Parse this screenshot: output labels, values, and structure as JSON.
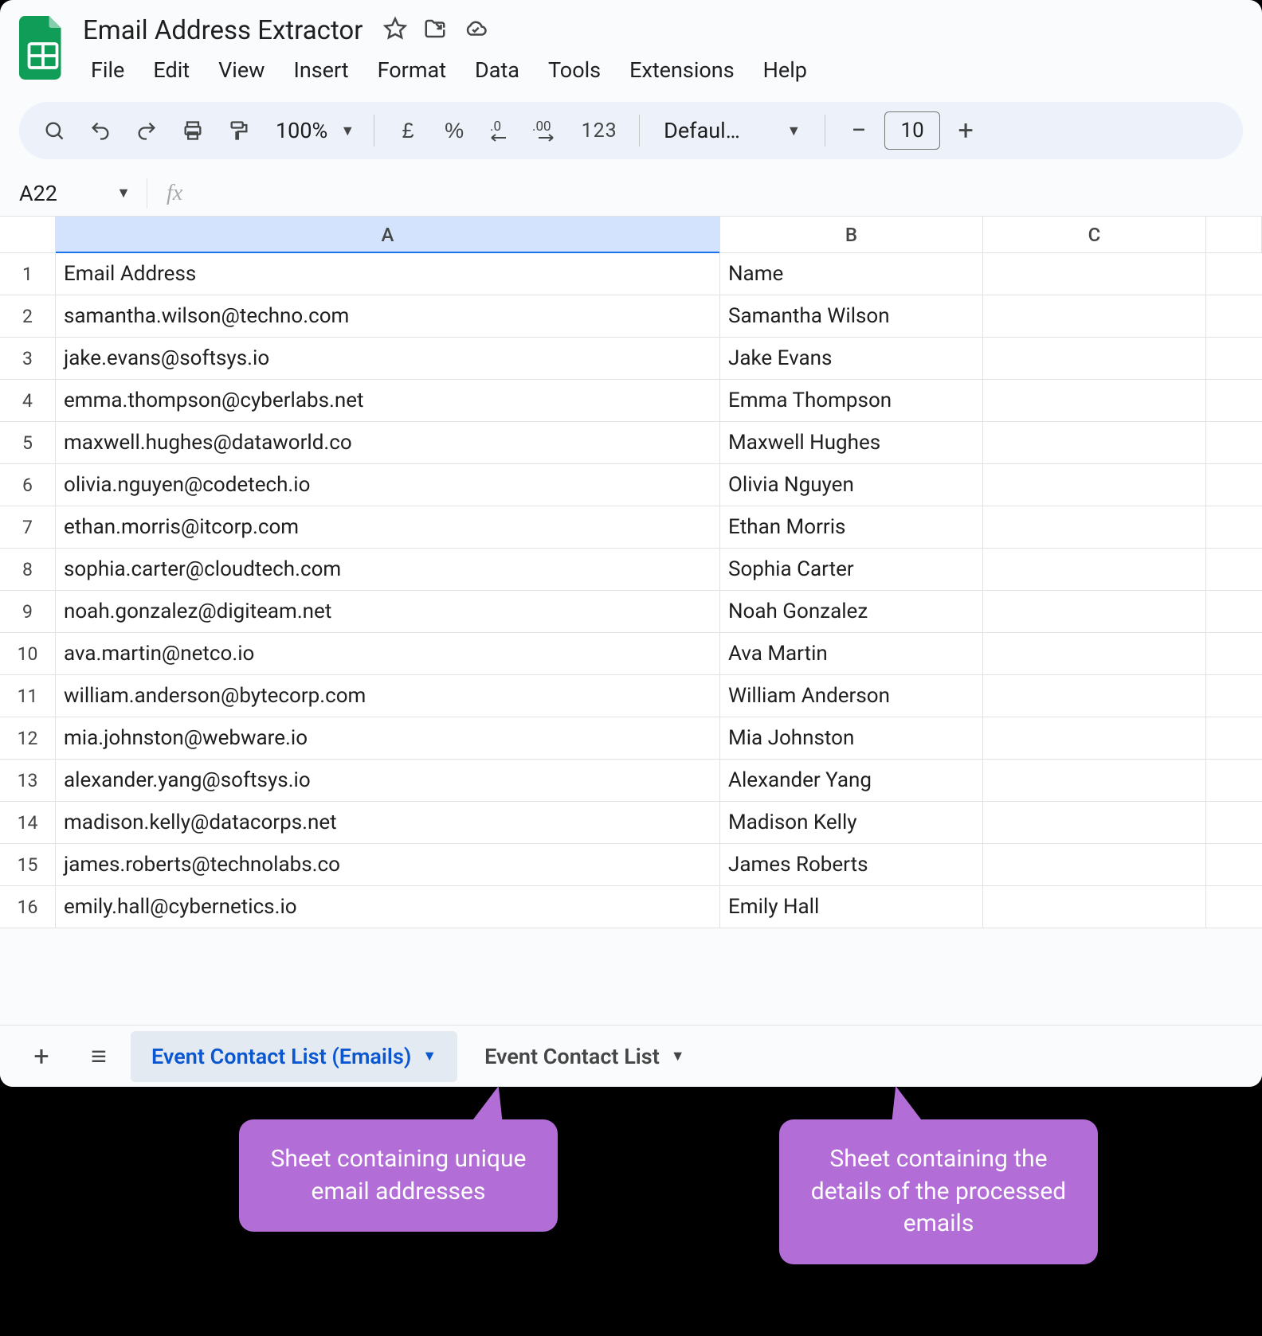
{
  "header": {
    "doc_title": "Email Address Extractor",
    "menus": [
      "File",
      "Edit",
      "View",
      "Insert",
      "Format",
      "Data",
      "Tools",
      "Extensions",
      "Help"
    ]
  },
  "toolbar": {
    "zoom": "100%",
    "currency": "£",
    "percent": "%",
    "dec_dec": ".0",
    "inc_dec": ".00",
    "numfmt": "123",
    "font": "Defaul…",
    "font_size": "10"
  },
  "namebox": "A22",
  "columns": [
    "A",
    "B",
    "C"
  ],
  "rows": [
    {
      "n": "1",
      "a": "Email Address",
      "b": "Name"
    },
    {
      "n": "2",
      "a": "samantha.wilson@techno.com",
      "b": "Samantha Wilson"
    },
    {
      "n": "3",
      "a": "jake.evans@softsys.io",
      "b": "Jake Evans"
    },
    {
      "n": "4",
      "a": "emma.thompson@cyberlabs.net",
      "b": "Emma Thompson"
    },
    {
      "n": "5",
      "a": "maxwell.hughes@dataworld.co",
      "b": "Maxwell Hughes"
    },
    {
      "n": "6",
      "a": "olivia.nguyen@codetech.io",
      "b": "Olivia Nguyen"
    },
    {
      "n": "7",
      "a": "ethan.morris@itcorp.com",
      "b": "Ethan Morris"
    },
    {
      "n": "8",
      "a": "sophia.carter@cloudtech.com",
      "b": "Sophia Carter"
    },
    {
      "n": "9",
      "a": "noah.gonzalez@digiteam.net",
      "b": "Noah Gonzalez"
    },
    {
      "n": "10",
      "a": "ava.martin@netco.io",
      "b": "Ava Martin"
    },
    {
      "n": "11",
      "a": "william.anderson@bytecorp.com",
      "b": "William Anderson"
    },
    {
      "n": "12",
      "a": "mia.johnston@webware.io",
      "b": "Mia Johnston"
    },
    {
      "n": "13",
      "a": "alexander.yang@softsys.io",
      "b": "Alexander Yang"
    },
    {
      "n": "14",
      "a": "madison.kelly@datacorps.net",
      "b": "Madison Kelly"
    },
    {
      "n": "15",
      "a": "james.roberts@technolabs.co",
      "b": "James Roberts"
    },
    {
      "n": "16",
      "a": "emily.hall@cybernetics.io",
      "b": "Emily Hall"
    }
  ],
  "sheets": {
    "active": "Event Contact List (Emails)",
    "other": "Event Contact List"
  },
  "callouts": {
    "left": "Sheet containing unique email addresses",
    "right": "Sheet containing the details of the processed emails"
  }
}
